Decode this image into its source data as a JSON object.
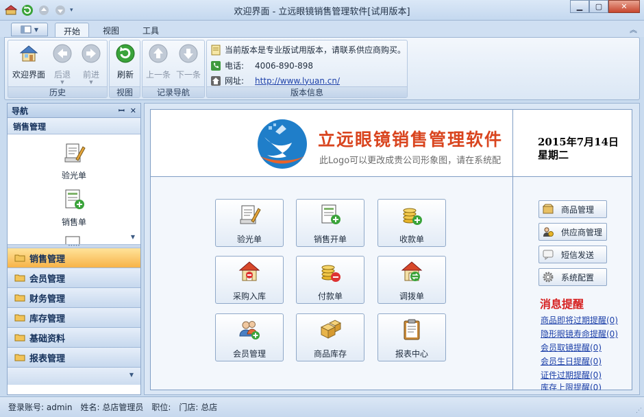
{
  "window": {
    "title": "欢迎界面 - 立远眼镜销售管理软件[试用版本]"
  },
  "ribbon_tabs": [
    {
      "label": "开始"
    },
    {
      "label": "视图"
    },
    {
      "label": "工具"
    }
  ],
  "ribbon": {
    "history": {
      "label": "历史",
      "buttons": [
        {
          "label": "欢迎界面"
        },
        {
          "label": "后退"
        },
        {
          "label": "前进"
        }
      ]
    },
    "view": {
      "label": "视图",
      "buttons": [
        {
          "label": "刷新"
        }
      ]
    },
    "record_nav": {
      "label": "记录导航",
      "buttons": [
        {
          "label": "上一条"
        },
        {
          "label": "下一条"
        }
      ]
    },
    "version": {
      "label": "版本信息",
      "notice": "当前版本是专业版试用版本，请联系供应商购买。",
      "phone_label": "电话:",
      "phone": "4006-890-898",
      "site_label": "网址:",
      "site": "http://www.lyuan.cn/"
    }
  },
  "nav": {
    "title": "导航",
    "section": "销售管理",
    "items": [
      {
        "label": "验光单"
      },
      {
        "label": "销售单"
      }
    ],
    "categories": [
      {
        "label": "销售管理"
      },
      {
        "label": "会员管理"
      },
      {
        "label": "财务管理"
      },
      {
        "label": "库存管理"
      },
      {
        "label": "基础资料"
      },
      {
        "label": "报表管理"
      }
    ]
  },
  "banner": {
    "title": "立远眼镜销售管理软件",
    "subtitle": "此Logo可以更改成贵公司形象图，请在系统配",
    "date": "2015年7月14日",
    "weekday": "星期二"
  },
  "tiles": [
    {
      "label": "验光单",
      "icon": "eye-test-icon"
    },
    {
      "label": "销售开单",
      "icon": "sales-order-icon"
    },
    {
      "label": "收款单",
      "icon": "receipt-coins-icon"
    },
    {
      "label": "采购入库",
      "icon": "purchase-warehouse-icon"
    },
    {
      "label": "付款单",
      "icon": "payment-coins-icon"
    },
    {
      "label": "调拨单",
      "icon": "transfer-warehouse-icon"
    },
    {
      "label": "会员管理",
      "icon": "member-icon"
    },
    {
      "label": "商品库存",
      "icon": "stock-boxes-icon"
    },
    {
      "label": "报表中心",
      "icon": "report-clipboard-icon"
    }
  ],
  "side_buttons": [
    {
      "label": "商品管理"
    },
    {
      "label": "供应商管理"
    },
    {
      "label": "短信发送"
    },
    {
      "label": "系统配置"
    }
  ],
  "messages": {
    "title": "消息提醒",
    "items": [
      "商品即将过期提醒(0)",
      "隐形眼镜寿命提醒(0)",
      "会员取镜提醒(0)",
      "会员生日提醒(0)",
      "证件过期提醒(0)",
      "库存上限提醒(0)"
    ]
  },
  "status": {
    "account": "登录账号: admin",
    "name": "姓名: 总店管理员",
    "position": "职位:",
    "store": "门店: 总店"
  }
}
